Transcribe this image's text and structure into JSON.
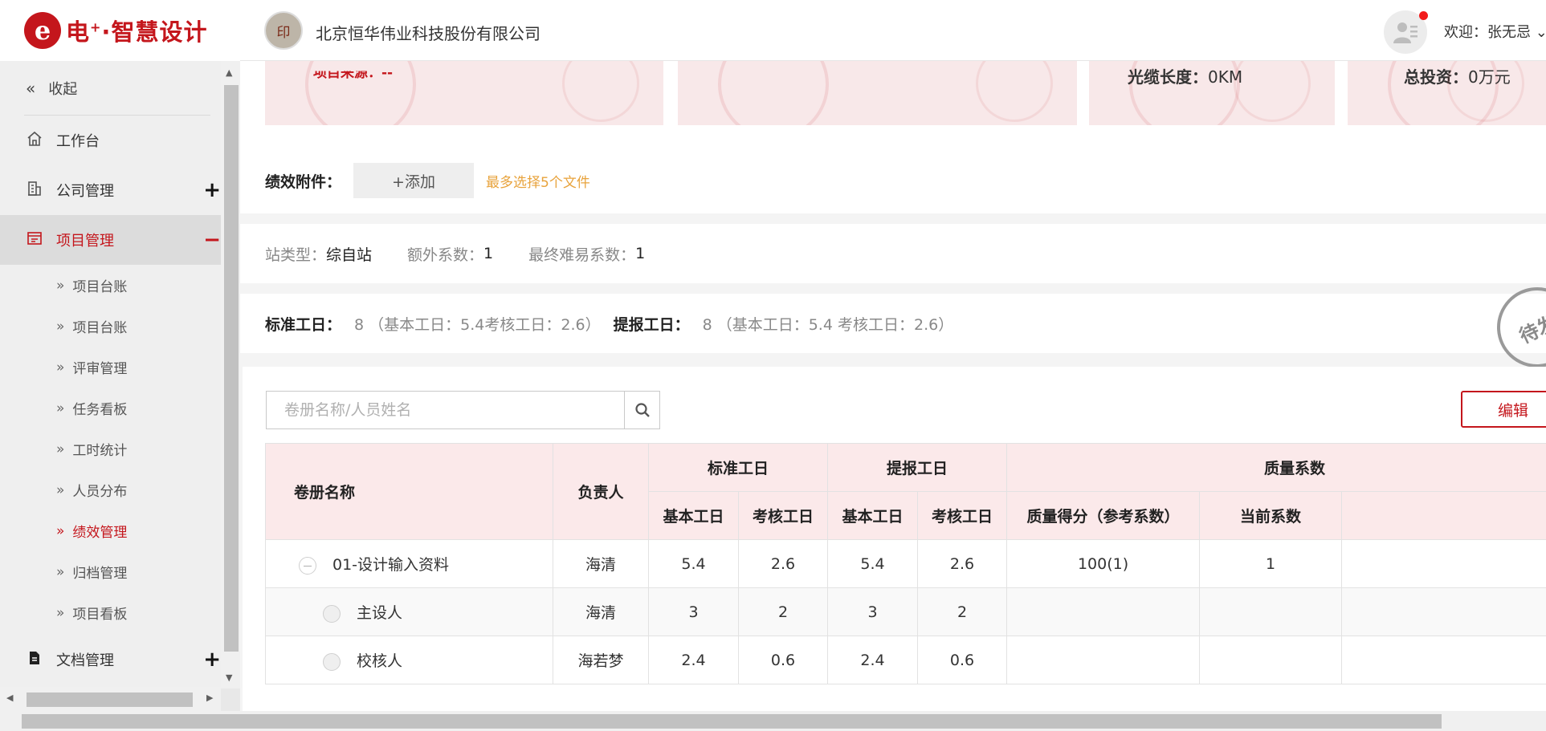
{
  "header": {
    "logo_letter": "e",
    "logo_main": "电",
    "logo_sup": "+",
    "logo_rest": "·智慧设计",
    "company_name": "北京恒华伟业科技股份有限公司",
    "welcome": "欢迎：张无忌 ⌄"
  },
  "sidebar": {
    "collapse_label": "收起",
    "items": [
      {
        "label": "工作台",
        "icon": "home-icon"
      },
      {
        "label": "公司管理",
        "icon": "building-icon",
        "toggle": "+"
      },
      {
        "label": "项目管理",
        "icon": "project-icon",
        "toggle": "−",
        "active": true
      },
      {
        "label": "文档管理",
        "icon": "document-icon",
        "toggle": "+"
      }
    ],
    "sub_items": [
      {
        "label": "项目台账"
      },
      {
        "label": "项目台账"
      },
      {
        "label": "评审管理"
      },
      {
        "label": "任务看板"
      },
      {
        "label": "工时统计"
      },
      {
        "label": "人员分布"
      },
      {
        "label": "绩效管理",
        "active": true
      },
      {
        "label": "归档管理"
      },
      {
        "label": "项目看板"
      }
    ]
  },
  "summary": {
    "project_source_label": "项目来源：--",
    "cable_length_label": "光缆长度：",
    "cable_length_value": "0KM",
    "total_investment_label": "总投资：",
    "total_investment_value": "0万元"
  },
  "attachment": {
    "label": "绩效附件：",
    "add_button": "+添加",
    "hint": "最多选择5个文件"
  },
  "station": {
    "type_label": "站类型：",
    "type_value": "综自站",
    "extra_coef_label": "额外系数：",
    "extra_coef_value": "1",
    "final_coef_label": "最终难易系数：",
    "final_coef_value": "1"
  },
  "workdays": {
    "standard_label": "标准工日：",
    "standard_value": "8 （基本工日：5.4考核工日：2.6）",
    "reported_label": "提报工日：",
    "reported_value": "8 （基本工日：5.4 考核工日：2.6）",
    "stamp": "待发"
  },
  "search": {
    "placeholder": "卷册名称/人员姓名",
    "value": ""
  },
  "edit_button": "编辑",
  "table": {
    "headers": {
      "volume_name": "卷册名称",
      "owner": "负责人",
      "standard": "标准工日",
      "reported": "提报工日",
      "quality": "质量系数",
      "basic": "基本工日",
      "assess": "考核工日",
      "quality_score": "质量得分（参考系数）",
      "current_coef": "当前系数"
    },
    "rows": [
      {
        "name": "01-设计输入资料",
        "owner": "海清",
        "std_basic": "5.4",
        "std_assess": "2.6",
        "rep_basic": "5.4",
        "rep_assess": "2.6",
        "quality_score": "100(1)",
        "current_coef": "1"
      },
      {
        "name": "主设人",
        "owner": "海清",
        "std_basic": "3",
        "std_assess": "2",
        "rep_basic": "3",
        "rep_assess": "2",
        "quality_score": "",
        "current_coef": ""
      },
      {
        "name": "校核人",
        "owner": "海若梦",
        "std_basic": "2.4",
        "std_assess": "0.6",
        "rep_basic": "2.4",
        "rep_assess": "0.6",
        "quality_score": "",
        "current_coef": ""
      }
    ]
  },
  "colors": {
    "brand_red": "#c4161c",
    "hint_orange": "#e8a33c",
    "header_pink": "#fbe9ea"
  }
}
